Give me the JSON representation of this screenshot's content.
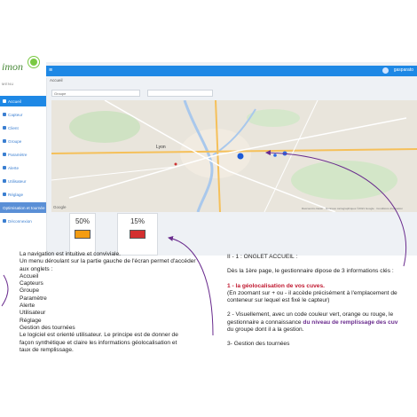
{
  "app": {
    "logo_text": "imon"
  },
  "topbar": {
    "user_label": "gasparato"
  },
  "sidebar": {
    "menu_header": "MENU",
    "items": [
      {
        "label": "Accueil"
      },
      {
        "label": "Capteur"
      },
      {
        "label": "Client"
      },
      {
        "label": "Groupe"
      },
      {
        "label": "Paramètre"
      },
      {
        "label": "Alerte"
      },
      {
        "label": "Utilisateur"
      },
      {
        "label": "Réglage"
      },
      {
        "label": "Optimisation et tournée"
      }
    ],
    "logout_label": "Déconnexion"
  },
  "main": {
    "breadcrumb": "Accueil",
    "group_select_value": "Groupe",
    "map_city_label": "Lyon",
    "map_credit": "Raccourcis clavier · Données cartographiques ©2021 Google · Conditions d'utilisation",
    "google_label": "Google",
    "cards": [
      {
        "percent": "50%",
        "level_color": "#f39c12",
        "fill_level": 0.5
      },
      {
        "percent": "15%",
        "level_color": "#d32f2f",
        "fill_level": 0.15
      }
    ]
  },
  "left_note": {
    "lines": [
      "La navigation est intuitive et conviviale.",
      "Un menu déroulant sur la partie gauche de l'écran permet d'accéder",
      "aux onglets :",
      "Accueil",
      "Capteurs",
      "Groupe",
      "Paramètre",
      "Alerte",
      "Utilisateur",
      "Réglage",
      "Gestion des tournées",
      "Le logiciel est orienté utilisateur. Le principe est de donner de",
      "façon synthétique et claire les informations géolocalisation et",
      "taux de remplissage."
    ]
  },
  "right_note": {
    "heading": "II - 1 : ONGLET ACCUEIL :",
    "intro": "Dès la 1ère page, le gestionnaire dipose de 3 informations clés :",
    "point1_prefix": "1 - la ",
    "point1_bold": "géolocalisation de vos cuves.",
    "point1_line2": "(En zoomant sur + ou - il accède précisément à l'emplacement de",
    "point1_line3": "conteneur sur lequel est fixé le capteur)",
    "point2_line1": "2 - Visuellement, avec un code couleur vert, orange ou rouge, le",
    "point2_prefix": "gestionnaire a connaissance ",
    "point2_bold": "du niveau de remplissage des cuv",
    "point2_line3": "du groupe dont il a la gestion.",
    "point3": "3- Gestion des tournées"
  },
  "colors": {
    "accent": "#1e88e5",
    "annotation_arrow": "#6a2c8e",
    "heading_red": "#c0182f"
  }
}
